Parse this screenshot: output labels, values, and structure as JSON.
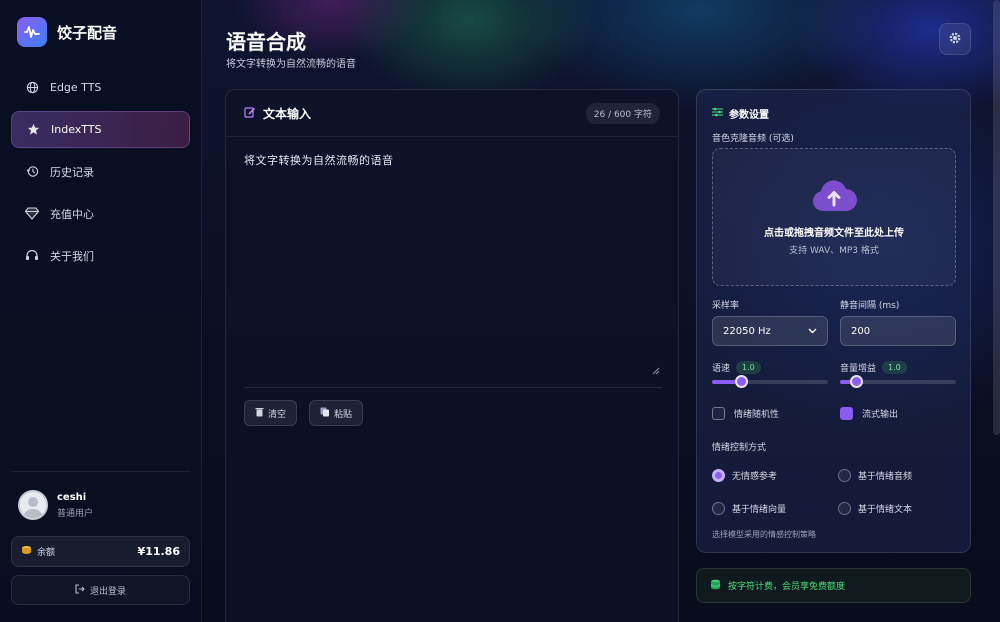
{
  "app": {
    "name": "饺子配音"
  },
  "sidebar": {
    "items": [
      {
        "label": "Edge TTS",
        "icon": "globe-icon",
        "active": false
      },
      {
        "label": "IndexTTS",
        "icon": "star-icon",
        "active": true
      },
      {
        "label": "历史记录",
        "icon": "history-icon",
        "active": false
      },
      {
        "label": "充值中心",
        "icon": "diamond-icon",
        "active": false
      },
      {
        "label": "关于我们",
        "icon": "headset-icon",
        "active": false
      }
    ],
    "user": {
      "name": "ceshi",
      "role": "普通用户"
    },
    "balance": {
      "label": "余额",
      "value": "¥11.86"
    },
    "logout_label": "退出登录"
  },
  "header": {
    "title": "语音合成",
    "subtitle": "将文字转换为自然流畅的语音"
  },
  "text_panel": {
    "title": "文本输入",
    "char_count": "26 / 600 字符",
    "content": "将文字转换为自然流畅的语音",
    "clear_label": "清空",
    "paste_label": "粘贴"
  },
  "params": {
    "title": "参数设置",
    "clone_label": "音色克隆音频 (可选)",
    "upload_text": "点击或拖拽音频文件至此处上传",
    "upload_hint": "支持 WAV、MP3 格式",
    "sample_rate_label": "采样率",
    "sample_rate_value": "22050 Hz",
    "silence_label": "静音间隔 (ms)",
    "silence_value": "200",
    "speed_label": "语速",
    "speed_value": "1.0",
    "speed_fraction": 0.25,
    "gain_label": "音量增益",
    "gain_value": "1.0",
    "gain_fraction": 0.14,
    "emotion_random_label": "情绪随机性",
    "emotion_random_checked": false,
    "stream_label": "流式输出",
    "stream_checked": true,
    "emotion_mode_label": "情绪控制方式",
    "emotion_options": [
      {
        "label": "无情感参考",
        "selected": true
      },
      {
        "label": "基于情绪音频",
        "selected": false
      },
      {
        "label": "基于情绪向量",
        "selected": false
      },
      {
        "label": "基于情绪文本",
        "selected": false
      }
    ],
    "emotion_hint": "选择模型采用的情感控制策略"
  },
  "billing": {
    "text": "按字符计费，会员享免费额度"
  },
  "colors": {
    "accent": "#8b5cf6",
    "success": "#4ade80"
  }
}
